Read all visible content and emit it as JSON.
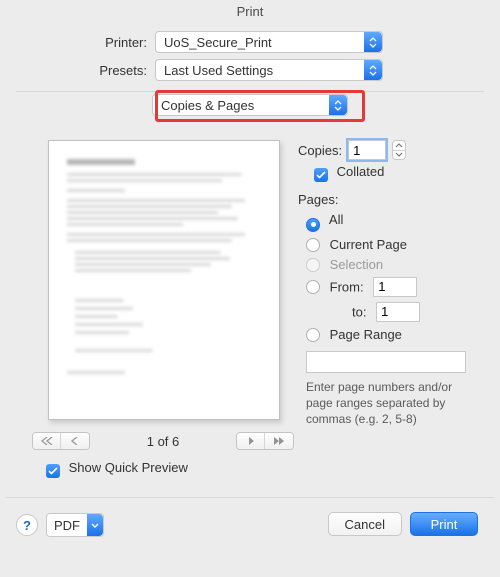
{
  "title": "Print",
  "form": {
    "printer_label": "Printer:",
    "printer_value": "UoS_Secure_Print",
    "presets_label": "Presets:",
    "presets_value": "Last Used Settings",
    "section_value": "Copies & Pages"
  },
  "copies": {
    "label": "Copies:",
    "value": "1",
    "collated_label": "Collated"
  },
  "pages": {
    "heading": "Pages:",
    "all": "All",
    "current": "Current Page",
    "selection": "Selection",
    "from_label": "From:",
    "from_value": "1",
    "to_label": "to:",
    "to_value": "1",
    "range_label": "Page Range",
    "hint": "Enter page numbers and/or page ranges separated by commas (e.g. 2, 5-8)"
  },
  "preview": {
    "counter": "1 of 6",
    "quick_preview_label": "Show Quick Preview"
  },
  "footer": {
    "pdf_label": "PDF",
    "cancel": "Cancel",
    "print": "Print"
  }
}
